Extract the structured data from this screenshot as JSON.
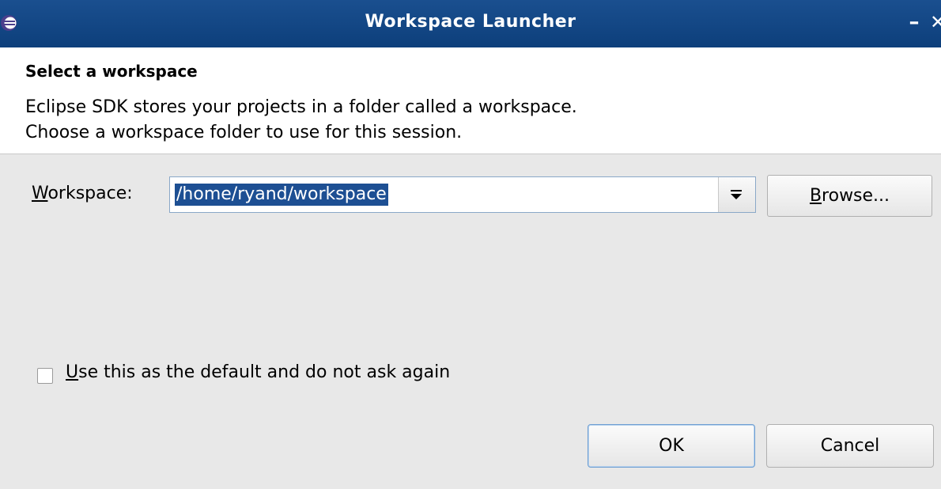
{
  "window": {
    "title": "Workspace Launcher",
    "minimize_glyph": "–",
    "close_glyph": "✕"
  },
  "header": {
    "title": "Select a workspace",
    "message_line1": "Eclipse SDK stores your projects in a folder called a workspace.",
    "message_line2": "Choose a workspace folder to use for this session."
  },
  "workspace": {
    "label_mnemonic": "W",
    "label_rest": "orkspace:",
    "value": "/home/ryand/workspace",
    "dropdown_icon": "dropdown-arrow-icon"
  },
  "browse_button": {
    "mnemonic": "B",
    "rest": "rowse..."
  },
  "default_checkbox": {
    "checked": false,
    "label_mnemonic": "U",
    "label_rest": "se this as the default and do not ask again"
  },
  "buttons": {
    "ok": "OK",
    "cancel": "Cancel"
  },
  "colors": {
    "titlebar": "#0d3f7b",
    "selection": "#1d4f93",
    "background": "#e8e8e8"
  },
  "icons": {
    "app": "eclipse-icon",
    "minimize": "minimize-icon",
    "close": "close-icon"
  }
}
